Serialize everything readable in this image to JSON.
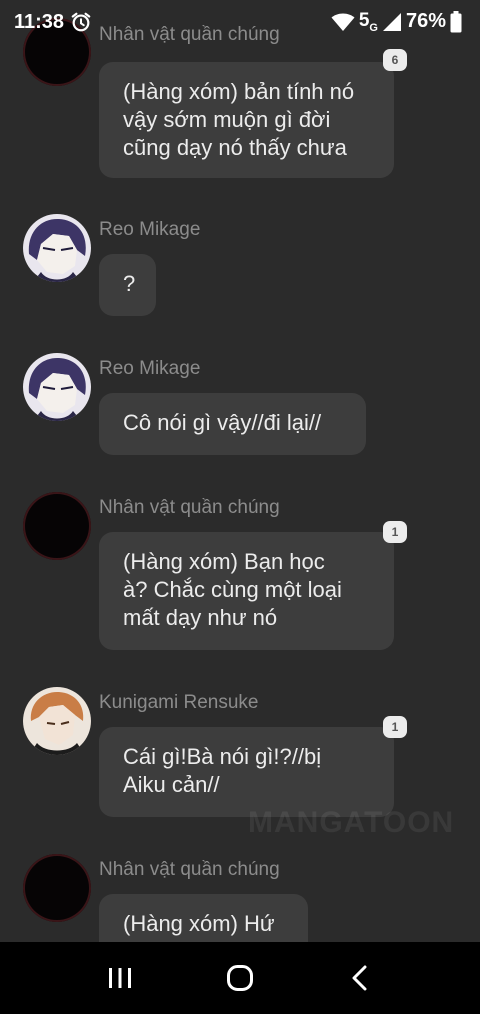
{
  "status_bar": {
    "time": "11:38",
    "alarm_icon": "alarm-icon",
    "wifi_icon": "wifi-icon",
    "network": "5",
    "network_sub": "G",
    "signal_icon": "signal-icon",
    "battery": "76%",
    "battery_icon": "battery-icon"
  },
  "messages": [
    {
      "name": "Nhân vật quần chúng",
      "avatar": "dark-avatar",
      "lines": [
        "(Hàng xóm) bản tính nó",
        "vậy sớm muộn gì đời",
        "cũng dạy nó thấy chưa"
      ],
      "badge": "6"
    },
    {
      "name": "Reo Mikage",
      "avatar": "reo-avatar",
      "lines": [
        "?"
      ],
      "badge": ""
    },
    {
      "name": "Reo Mikage",
      "avatar": "reo-avatar",
      "lines": [
        "Cô nói gì vậy//đi lại//"
      ],
      "badge": ""
    },
    {
      "name": "Nhân vật quần chúng",
      "avatar": "dark-avatar",
      "lines": [
        "(Hàng xóm) Bạn học",
        "à? Chắc cùng một loại",
        "mất dạy như nó"
      ],
      "badge": "1"
    },
    {
      "name": "Kunigami Rensuke",
      "avatar": "kunigami-avatar",
      "lines": [
        "Cái gì!Bà nói gì!?//bị",
        "Aiku cản//"
      ],
      "badge": "1"
    },
    {
      "name": "Nhân vật quần chúng",
      "avatar": "dark-avatar",
      "lines": [
        "(Hàng xóm) Hứ"
      ],
      "badge": ""
    }
  ],
  "watermark": "MANGATOON",
  "nav": {
    "recents_icon": "recents-icon",
    "home_icon": "home-icon",
    "back_icon": "back-icon"
  }
}
